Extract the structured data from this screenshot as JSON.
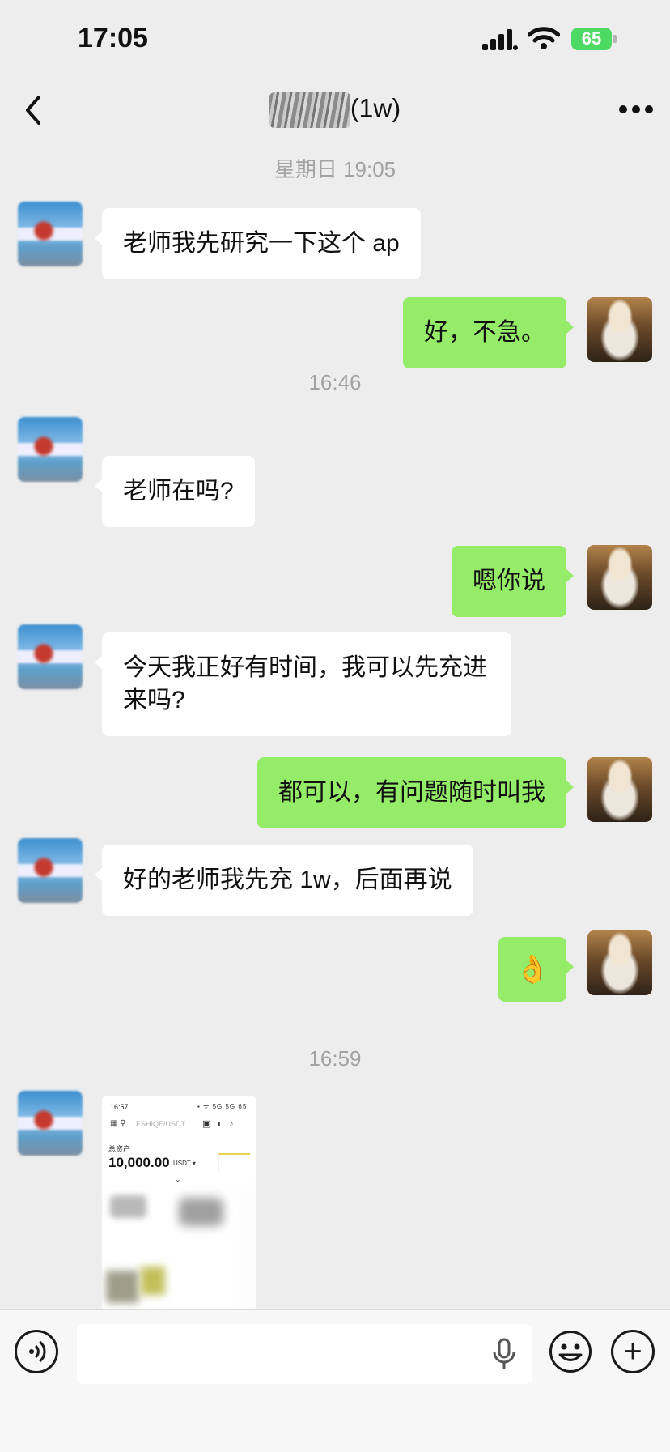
{
  "status_bar": {
    "time": "17:05",
    "battery": "65"
  },
  "header": {
    "title_suffix": "(1w)"
  },
  "messages": [
    {
      "type": "timestamp",
      "text": "星期日 19:05"
    },
    {
      "type": "incoming",
      "text": "老师我先研究一下这个 ap"
    },
    {
      "type": "outgoing",
      "text": "好，不急。"
    },
    {
      "type": "timestamp",
      "text": "16:46"
    },
    {
      "type": "incoming",
      "text": "老师在吗?"
    },
    {
      "type": "outgoing",
      "text": "嗯你说"
    },
    {
      "type": "incoming",
      "text": "今天我正好有时间，我可以先充进来吗?"
    },
    {
      "type": "outgoing",
      "text": "都可以，有问题随时叫我"
    },
    {
      "type": "incoming",
      "text": "好的老师我先充 1w，后面再说"
    },
    {
      "type": "outgoing",
      "text": "👌"
    },
    {
      "type": "timestamp",
      "text": "16:59"
    },
    {
      "type": "incoming-image"
    }
  ],
  "screenshot_image": {
    "time": "16:57",
    "status": "▪︎ ᯤ 5G 5G 65",
    "search_placeholder": "ESHIQE/USDT",
    "label": "总资产",
    "amount": "10,000.00",
    "unit": "USDT ▾",
    "chevron": "⌄"
  },
  "input_bar": {
    "placeholder": ""
  },
  "colors": {
    "background": "#ededed",
    "outgoing_bubble": "#95ec69",
    "incoming_bubble": "#ffffff"
  }
}
